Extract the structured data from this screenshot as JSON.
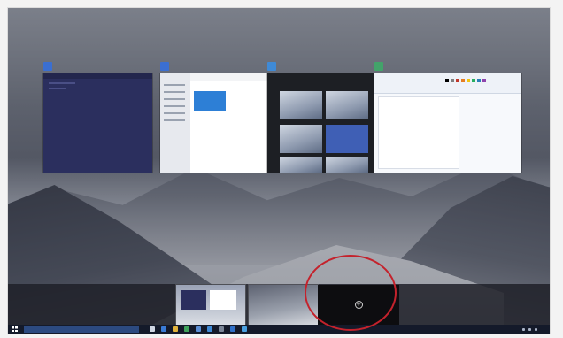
{
  "task_view": {
    "windows": [
      {
        "title": "",
        "icon": "app-icon",
        "accent": "#3b6fd1"
      },
      {
        "title": "",
        "icon": "settings-icon",
        "accent": "#3b6fd1"
      },
      {
        "title": "",
        "icon": "photos-icon",
        "accent": "#3f8ad6"
      },
      {
        "title": "",
        "icon": "paint-icon",
        "accent": "#43a36a"
      }
    ],
    "close_glyph": "×"
  },
  "desktops": {
    "new_desktop_icon": "plus-icon",
    "new_desktop_glyph": "+"
  },
  "taskbar": {
    "start_icon": "windows-logo-icon",
    "search_placeholder": "",
    "pinned_icons": [
      "task-view-icon",
      "edge-icon",
      "file-explorer-icon",
      "store-icon",
      "mail-icon",
      "photos-icon",
      "settings-icon",
      "paint-icon",
      "app-icon"
    ],
    "clock": ""
  },
  "colors": {
    "highlight_ring": "#c4222c",
    "taskbar": "#141a2a"
  }
}
